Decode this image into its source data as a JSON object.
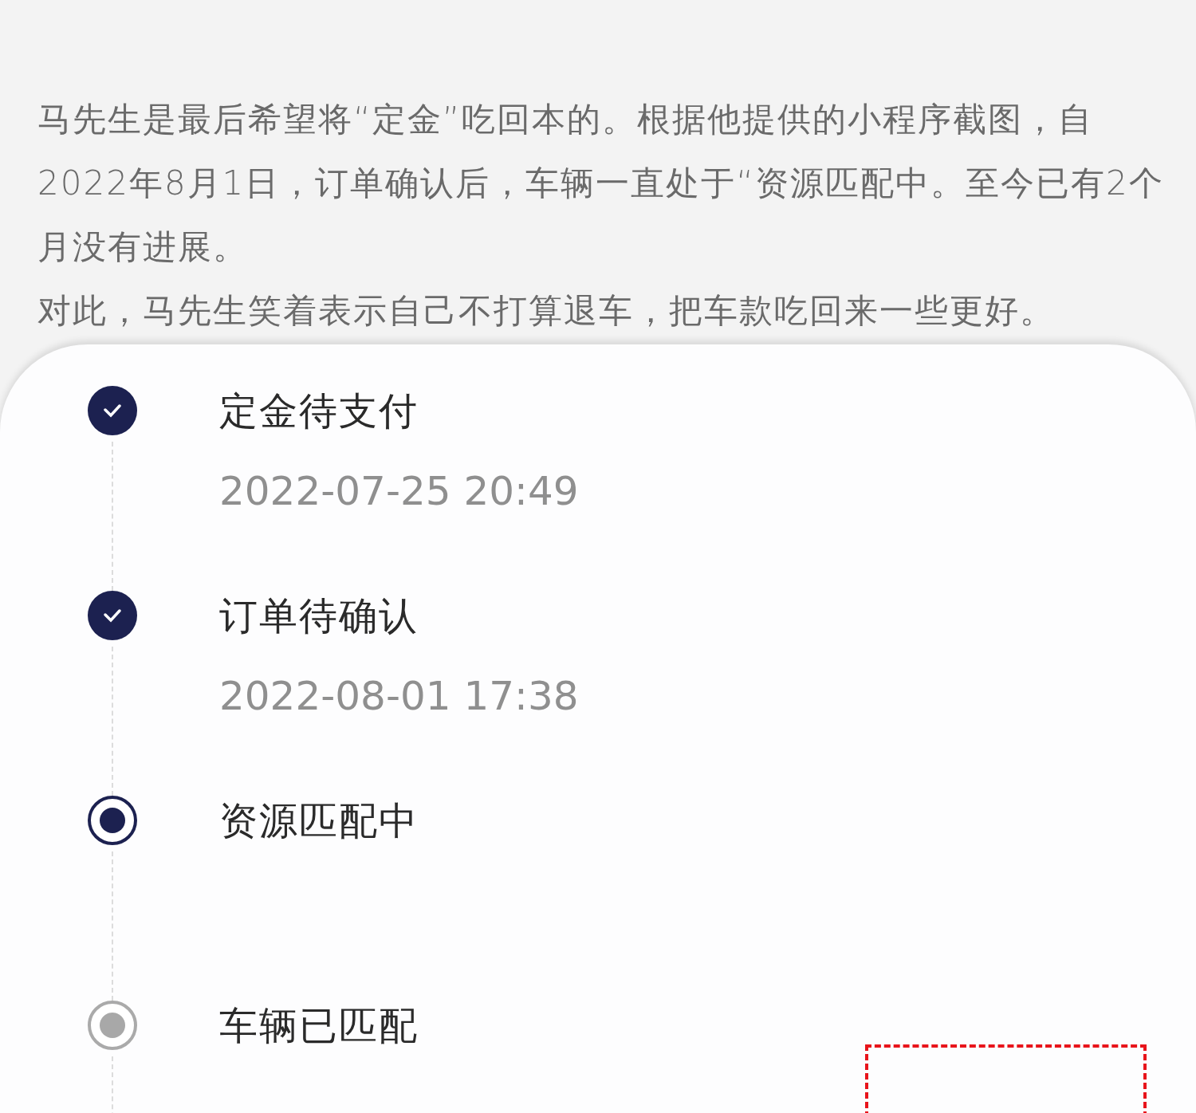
{
  "article": {
    "paragraphs": [
      "马先生是最后希望将“定金”吃回本的。根据他提供的小程序截图，自2022年8月1日，订单确认后，车辆一直处于“资源匹配中。至今已有2个月没有进展。",
      "对此，马先生笑着表示自己不打算退车，把车款吃回来一些更好。"
    ]
  },
  "order_progress": {
    "steps": [
      {
        "title": "定金待支付",
        "time": "2022-07-25 20:49",
        "kind": "done"
      },
      {
        "title": "订单待确认",
        "time": "2022-08-01 17:38",
        "kind": "done"
      },
      {
        "title": "资源匹配中",
        "kind": "current"
      },
      {
        "title": "车辆已匹配",
        "kind": "pending"
      }
    ]
  }
}
